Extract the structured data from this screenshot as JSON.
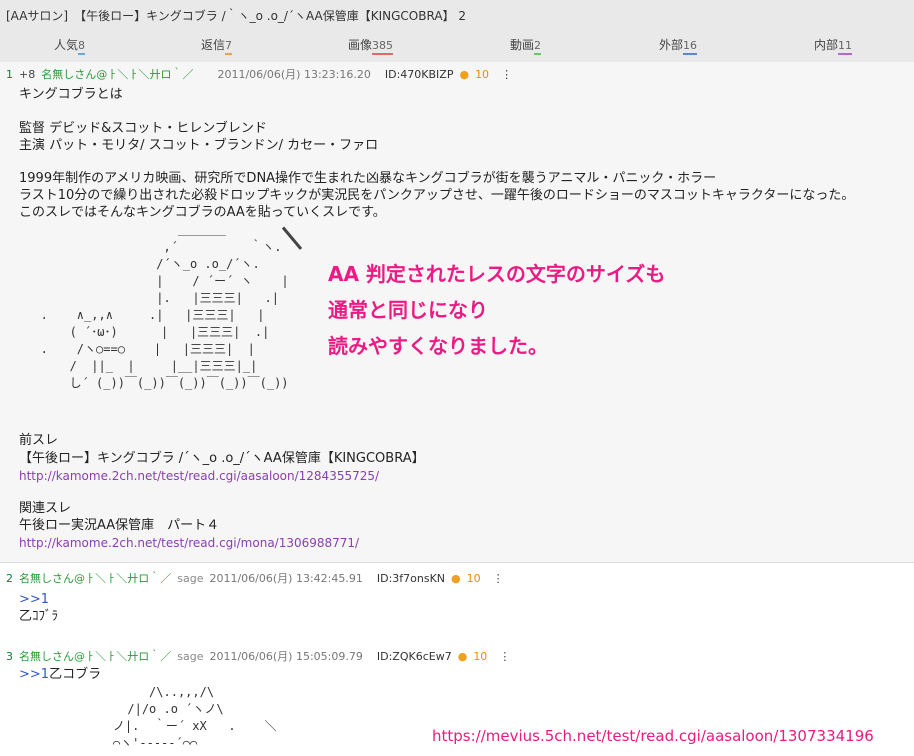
{
  "header": {
    "title": "[AAサロン]　【午後ロー】キングコブラ /｀ヽ_o .o_/´ヽAA保管庫【KINGCOBRA】 2",
    "tabs": [
      {
        "label": "人気",
        "count": "8",
        "color": "#6aa9e0"
      },
      {
        "label": "返信",
        "count": "7",
        "color": "#f0a050"
      },
      {
        "label": "画像",
        "count": "385",
        "color": "#e06a6a"
      },
      {
        "label": "動画",
        "count": "2",
        "color": "#6ac46a"
      },
      {
        "label": "外部",
        "count": "16",
        "color": "#5b86d6"
      },
      {
        "label": "内部",
        "count": "11",
        "color": "#b06ad0"
      }
    ]
  },
  "posts": [
    {
      "num": "1",
      "plus": "+8",
      "name": "名無しさん@ㅏ＼ㅏ＼廾ロ｀／",
      "sage": "",
      "date": "2011/06/06(月) 13:23:16.20",
      "id": "ID:470KBIZP",
      "replies": "10",
      "lines": [
        "キングコブラとは",
        "監督 デビッド&スコット・ヒレンブレンド",
        "主演 パット・モリタ/ スコット・ブランドン/ カセー・ファロ",
        "1999年制作のアメリカ映画、研究所でDNA操作で生まれた凶暴なキングコブラが街を襲うアニマル・パニック・ホラー",
        "ラスト10分ので繰り出された必殺ドロップキックが実況民をパンクアップさせ、一躍午後のロードショーのマスコットキャラクターになった。",
        "このスレではそんなキングコブラのAAを貼っていくスレです。"
      ],
      "aa": "                      ＿＿＿＿\n                    ,´          ｀ヽ.\n                   /´ヽ_o .o_/´ヽ.\n                   |    / ´ー´ ヽ    |\n                   |.   |三三三|   .|\n   .    ∧_,,∧     .|   |三三三|   |\n       ( ´･ω･)      |   |三三三|  .|\n   .    /ヽ○==○    |   |三三三|  |\n       /  ||_  |     |__|三三三|_|\n       し´ (_))￣(_))￣(_))￣(_))￣(_))",
      "prev_label": "前スレ",
      "prev_title": "【午後ロー】キングコブラ /´ヽ_o .o_/´ヽAA保管庫【KINGCOBRA】",
      "prev_url": "http://kamome.2ch.net/test/read.cgi/aasaloon/1284355725/",
      "rel_label": "関連スレ",
      "rel_title": "午後ロー実況AA保管庫　パート４",
      "rel_url": "http://kamome.2ch.net/test/read.cgi/mona/1306988771/"
    },
    {
      "num": "2",
      "name": "名無しさん@ㅏ＼ㅏ＼廾ロ｀／",
      "sage": "sage",
      "date": "2011/06/06(月) 13:42:45.91",
      "id": "ID:3f7onsKN",
      "replies": "10",
      "anchor": ">>1",
      "text": "乙ｺﾌﾞﾗ"
    },
    {
      "num": "3",
      "name": "名無しさん@ㅏ＼ㅏ＼廾ロ｀／",
      "sage": "sage",
      "date": "2011/06/06(月) 15:05:09.79",
      "id": "ID:ZQK6cEw7",
      "replies": "10",
      "anchor": ">>1",
      "text": "乙コブラ",
      "aa": "                  /\\..,,,/\\\n               /|/o .o ´ヽノ\\\n             ノ|.  ｀ー´ xX   .    ＼\n             ⌒ヽ'-----´⌒⌒"
    }
  ],
  "callout": {
    "lines": [
      "AA 判定されたレスの文字のサイズも",
      "通常と同じになり",
      "読みやすくなりました。"
    ],
    "color": "#ec1a83"
  },
  "footer_url": "https://mevius.5ch.net/test/read.cgi/aasaloon/1307334196"
}
